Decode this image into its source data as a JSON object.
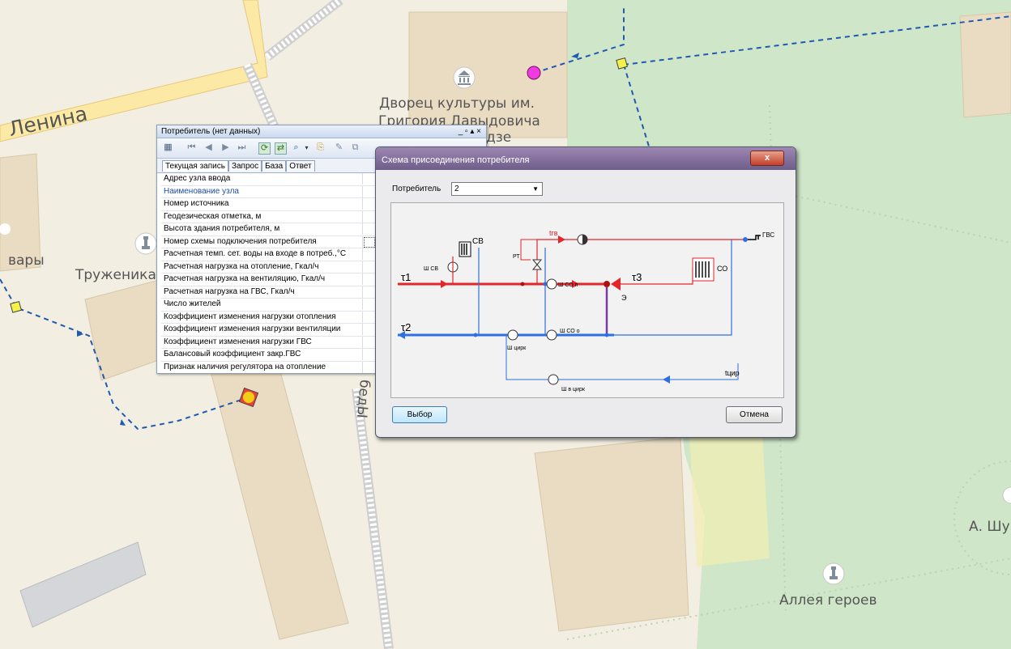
{
  "map": {
    "labels": {
      "street_lenina": "Ленина",
      "palace_line1": "Дворец культуры им.",
      "palace_line2": "Григория Давыдовича",
      "palace_line3": "дзе",
      "varvary": "вары",
      "truzhenika": "Труженика",
      "pobedy": "бедЫ",
      "alley": "Аллея героев",
      "a_shu": "А. Шу"
    },
    "colors": {
      "road": "#fde9a6",
      "park": "#cfe6c9",
      "building": "#e8dcc3",
      "network": "#1f59b3"
    }
  },
  "consumer_window": {
    "title": "Потребитель (нет данных)",
    "controls": "_ ▫ ▴ ×",
    "tabs": [
      "Текущая запись",
      "Запрос",
      "База",
      "Ответ"
    ],
    "fields": [
      "Адрес узла ввода",
      "Наименование узла",
      "Номер источника",
      "Геодезическая отметка, м",
      "Высота здания потребителя, м",
      "Номер схемы подключения потребителя",
      "Расчетная темп. сет. воды на входе в потреб.,°С",
      "Расчетная нагрузка на отопление, Гкал/ч",
      "Расчетная нагрузка на вентиляцию, Гкал/ч",
      "Расчетная нагрузка на ГВС, Гкал/ч",
      "Число жителей",
      "Коэффициент изменения нагрузки отопления",
      "Коэффициент изменения нагрузки вентиляции",
      "Коэффициент изменения нагрузки ГВС",
      "Балансовый коэффициент закр.ГВС",
      "Признак наличия регулятора на отопление"
    ]
  },
  "scheme_dialog": {
    "title": "Схема присоединения потребителя",
    "close": "x",
    "field_label": "Потребитель",
    "field_value": "2",
    "ok_label": "Выбор",
    "cancel_label": "Отмена",
    "diagram_labels": {
      "sv": "СВ",
      "shsv": "Ш СВ",
      "rt": "РТ",
      "tgv": "tгв",
      "gvs": "ГВС",
      "t1": "τ1",
      "t2": "τ2",
      "t3": "τ3",
      "shco_p": "Ш СО п",
      "shco_o": "Ш СО о",
      "co": "СО",
      "e": "Э",
      "shcirk": "Ш цирк",
      "tcirk": "tцир",
      "shvcirk": "Ш в цирк"
    },
    "colors": {
      "supply": "#e2262b",
      "return": "#2e6fe3",
      "circ": "#2e6fe3",
      "mixed": "#7b3aa3"
    }
  }
}
